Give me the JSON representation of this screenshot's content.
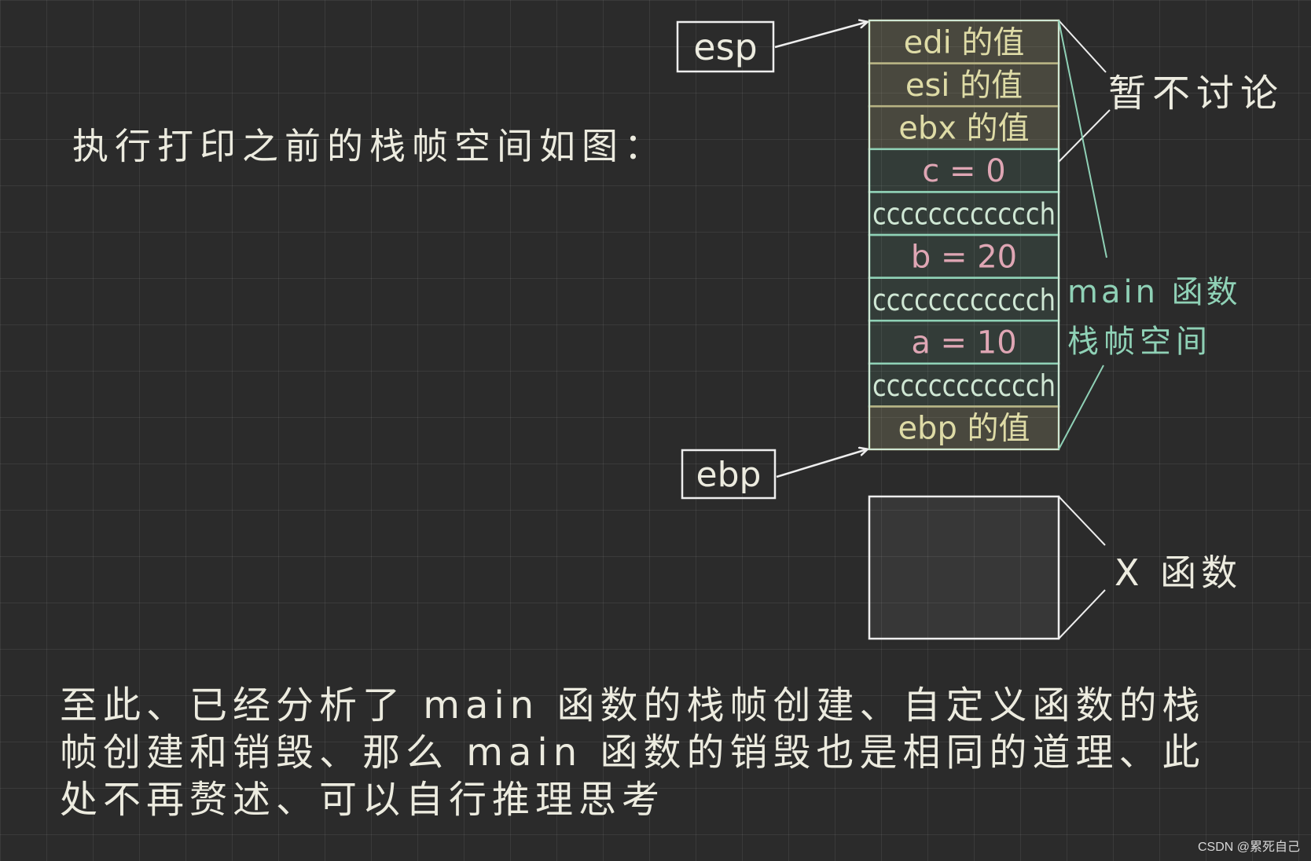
{
  "intro_text": "执行打印之前的栈帧空间如图：",
  "pointers": {
    "esp": "esp",
    "ebp": "ebp"
  },
  "stack_cells": [
    {
      "text": "edi 的值",
      "kind": "saved"
    },
    {
      "text": "esi 的值",
      "kind": "saved"
    },
    {
      "text": "ebx 的值",
      "kind": "saved"
    },
    {
      "text": "c = 0",
      "kind": "var"
    },
    {
      "text": "cccccccccccch",
      "kind": "pad"
    },
    {
      "text": "b = 20",
      "kind": "var"
    },
    {
      "text": "cccccccccccch",
      "kind": "pad"
    },
    {
      "text": "a = 10",
      "kind": "var"
    },
    {
      "text": "cccccccccccch",
      "kind": "pad"
    },
    {
      "text": "ebp 的值",
      "kind": "saved"
    }
  ],
  "annotations": {
    "registers_note": "暂不讨论",
    "main_frame_line1": "main 函数",
    "main_frame_line2": "栈帧空间",
    "x_frame": "X 函数"
  },
  "notes": [
    "至此、已经分析了 main 函数的栈帧创建、自定义函数的栈",
    "帧创建和销毁、那么 main 函数的销毁也是相同的道理、此",
    "处不再赘述、可以自行推理思考"
  ],
  "credit": "CSDN @累死自己",
  "colors": {
    "background": "#2b2b2b",
    "saved_fill": "#b7b383",
    "saved_text": "#dedba6",
    "main_fill": "#7fd4b0",
    "var_text": "#dfa6b4",
    "pad_text": "#cfe7d4",
    "teal_line": "#8fd1b6",
    "white_line": "#eeeeee"
  }
}
